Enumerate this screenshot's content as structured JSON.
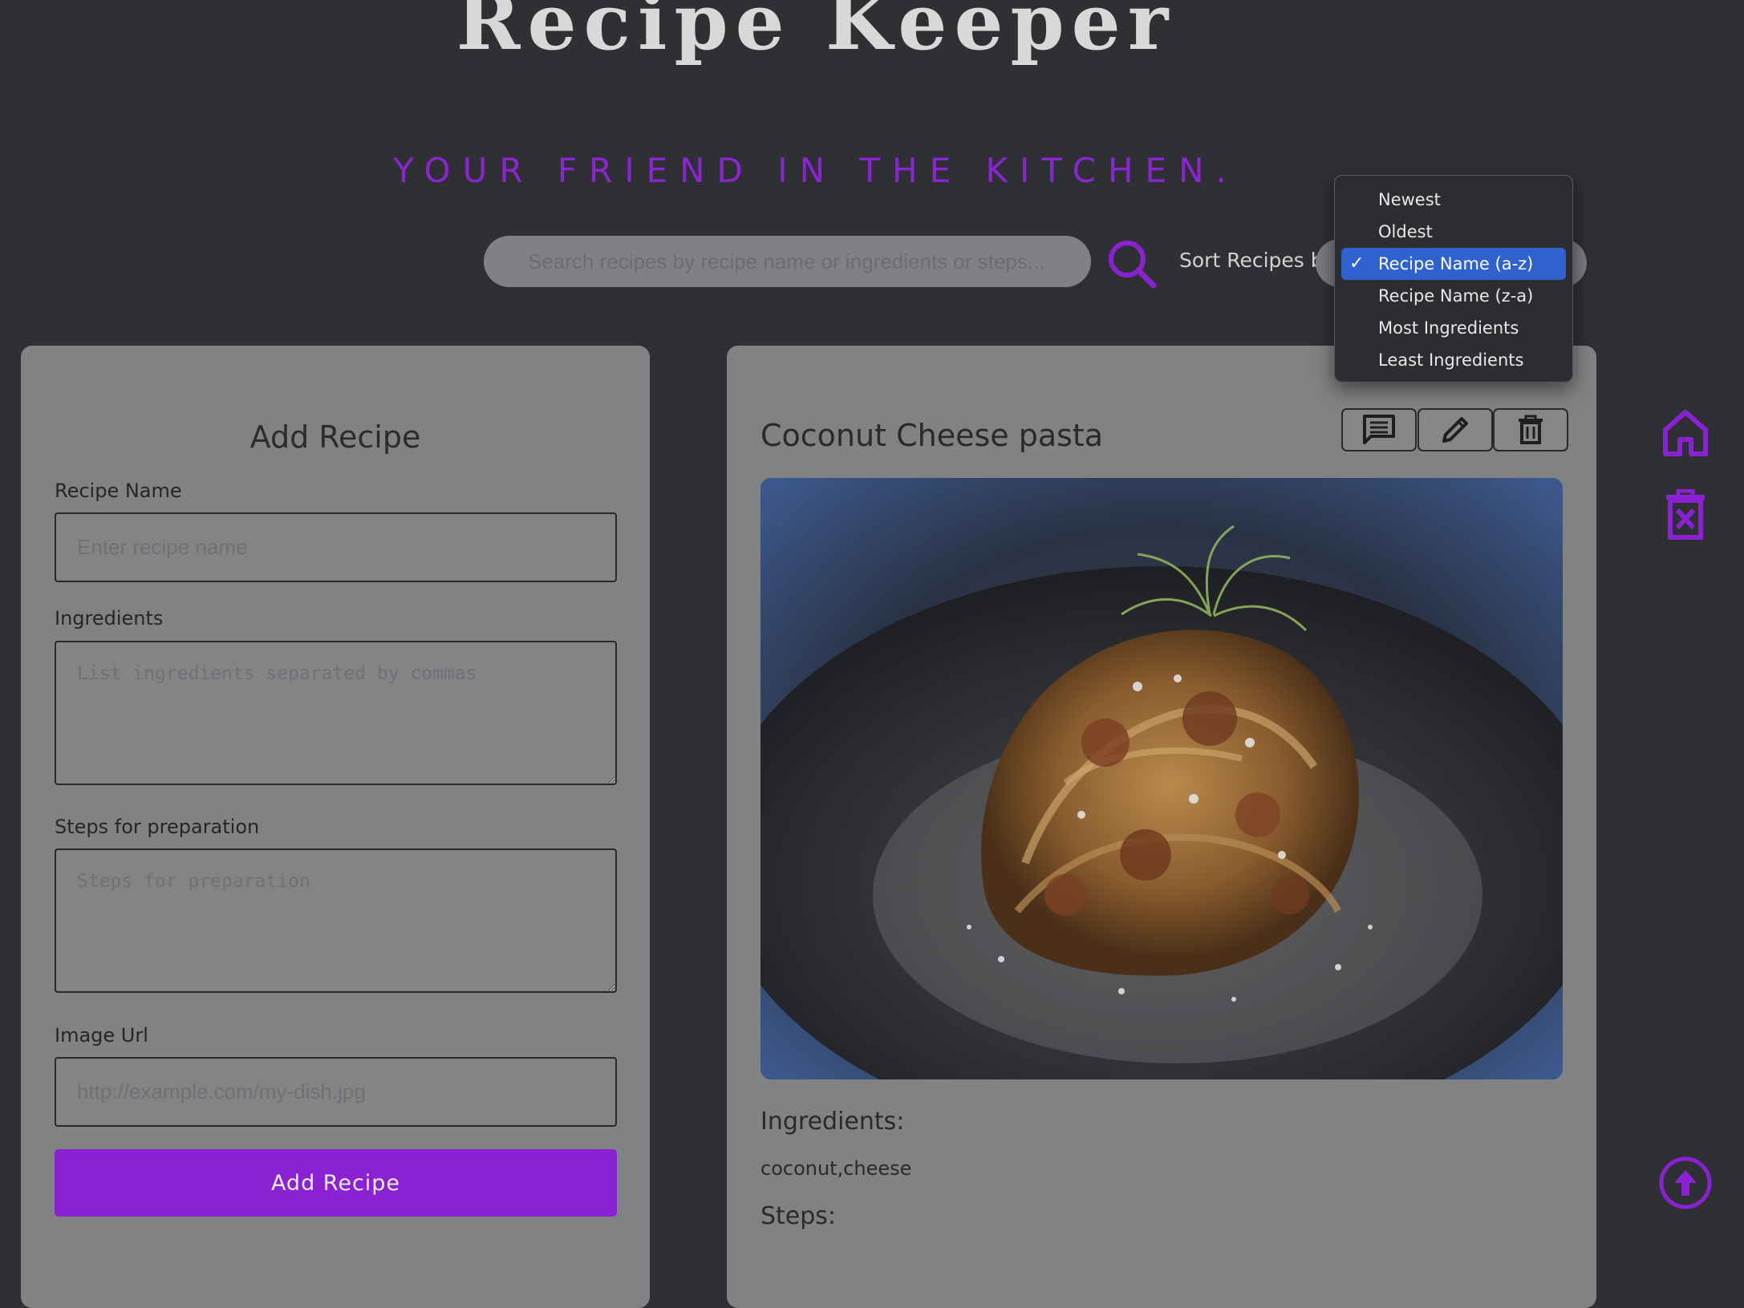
{
  "header": {
    "title": "Recipe Keeper",
    "tagline": "YOUR FRIEND IN THE KITCHEN."
  },
  "search": {
    "placeholder": "Search recipes by recipe name or ingredients or steps..."
  },
  "sort": {
    "label": "Sort Recipes by",
    "options": [
      "Newest",
      "Oldest",
      "Recipe Name (a-z)",
      "Recipe Name (z-a)",
      "Most Ingredients",
      "Least Ingredients"
    ],
    "selected": "Recipe Name (a-z)",
    "check": "✓"
  },
  "add_form": {
    "title": "Add Recipe",
    "name_label": "Recipe Name",
    "name_placeholder": "Enter recipe name",
    "ingredients_label": "Ingredients",
    "ingredients_placeholder": "List ingredients separated by commas",
    "steps_label": "Steps for preparation",
    "steps_placeholder": "Steps for preparation",
    "image_label": "Image Url",
    "image_placeholder": "http://example.com/my-dish.jpg",
    "submit_label": "Add Recipe"
  },
  "recipe": {
    "name": "Coconut Cheese pasta",
    "ingredients_label": "Ingredients:",
    "ingredients": "coconut,cheese",
    "steps_label": "Steps:"
  },
  "colors": {
    "accent": "#8a22d4",
    "background": "#2f3033",
    "panel": "#818284",
    "dropdown_selected": "#2f62cf"
  },
  "icons": {
    "search": "search-icon",
    "comment": "comment-icon",
    "edit": "pencil-icon",
    "delete": "trash-icon",
    "home": "home-icon",
    "clear": "trash-x-icon",
    "scroll_top": "arrow-up-circle-icon"
  }
}
